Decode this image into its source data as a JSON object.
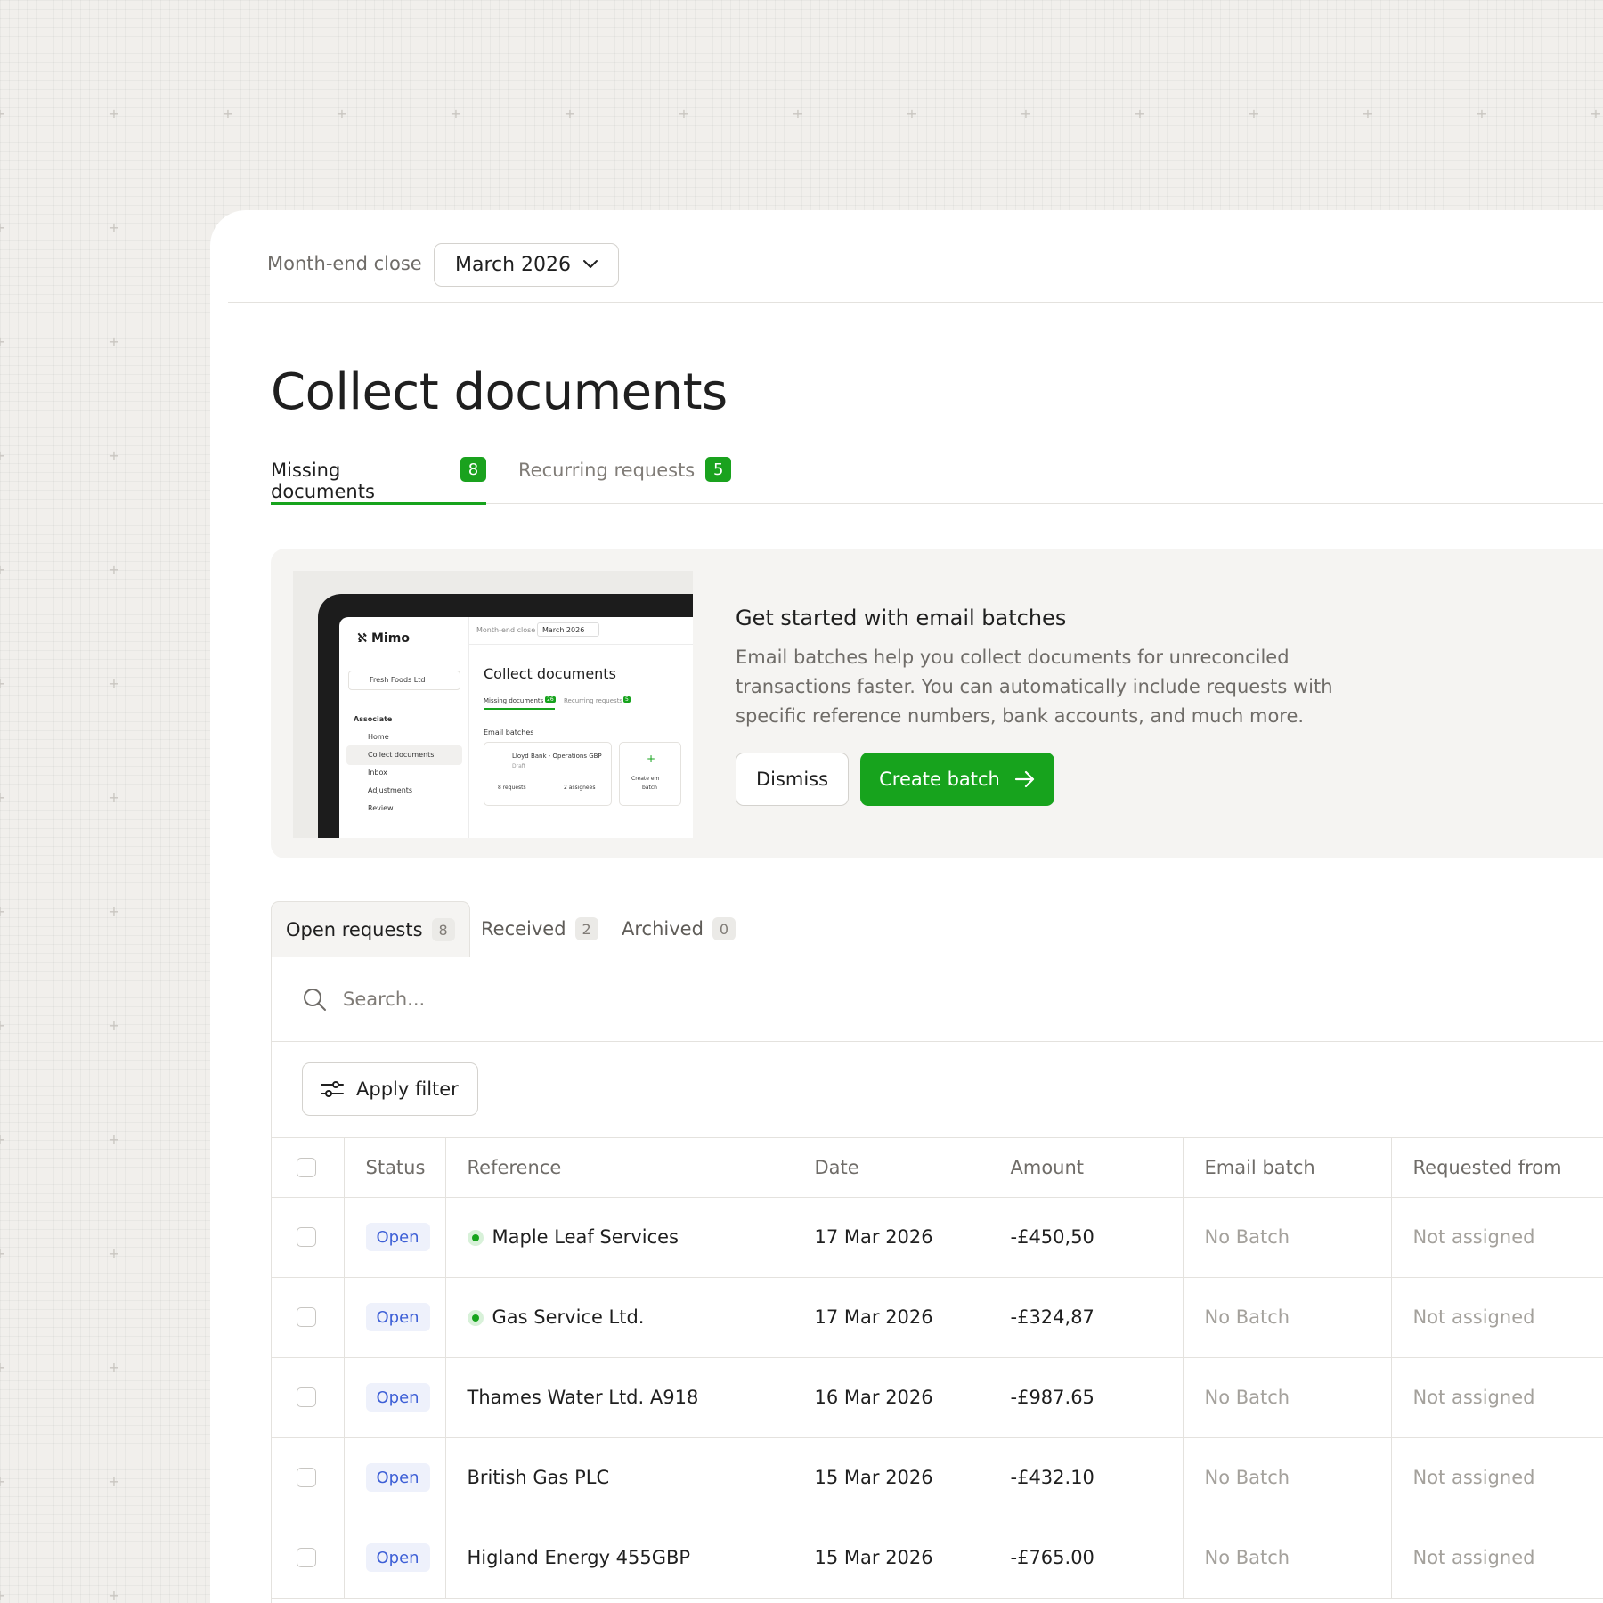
{
  "header": {
    "label": "Month-end close",
    "period": "March 2026"
  },
  "page": {
    "title": "Collect documents"
  },
  "tabs": [
    {
      "label": "Missing documents",
      "count": "8"
    },
    {
      "label": "Recurring requests",
      "count": "5"
    }
  ],
  "promo": {
    "title": "Get started with email batches",
    "text": "Email batches help you collect documents for unreconciled transactions faster. You can automatically include requests with specific reference numbers, bank accounts, and much more.",
    "dismiss_label": "Dismiss",
    "create_label": "Create batch",
    "preview": {
      "app_name": "Mimo",
      "client": "Fresh Foods Ltd",
      "section": "Associate",
      "nav": [
        "Home",
        "Collect documents",
        "Inbox",
        "Adjustments",
        "Review"
      ],
      "header_label": "Month-end close",
      "period": "March 2026",
      "title": "Collect documents",
      "tab1": "Missing documents",
      "tab1_count": "26",
      "tab2": "Recurring requests",
      "tab2_count": "5",
      "batches_label": "Email batches",
      "batch_name": "Lloyd Bank - Operations GBP",
      "batch_status": "Draft",
      "batch_requests": "8 requests",
      "batch_assignees": "2 assignees",
      "create_label_1": "Create em",
      "create_label_2": "batch"
    }
  },
  "request_tabs": [
    {
      "label": "Open requests",
      "count": "8"
    },
    {
      "label": "Received",
      "count": "2"
    },
    {
      "label": "Archived",
      "count": "0"
    }
  ],
  "search": {
    "placeholder": "Search..."
  },
  "filter": {
    "label": "Apply filter"
  },
  "table": {
    "columns": [
      "Status",
      "Reference",
      "Date",
      "Amount",
      "Email batch",
      "Requested from"
    ],
    "rows": [
      {
        "status": "Open",
        "reference": "Maple Leaf Services",
        "dot": true,
        "date": "17 Mar 2026",
        "amount": "-£450,50",
        "batch": "No Batch",
        "requested": "Not assigned"
      },
      {
        "status": "Open",
        "reference": "Gas Service Ltd.",
        "dot": true,
        "date": "17 Mar 2026",
        "amount": "-£324,87",
        "batch": "No Batch",
        "requested": "Not assigned"
      },
      {
        "status": "Open",
        "reference": "Thames Water Ltd. A918",
        "dot": false,
        "date": "16 Mar 2026",
        "amount": "-£987.65",
        "batch": "No Batch",
        "requested": "Not assigned"
      },
      {
        "status": "Open",
        "reference": "British Gas PLC",
        "dot": false,
        "date": "15 Mar 2026",
        "amount": "-£432.10",
        "batch": "No Batch",
        "requested": "Not assigned"
      },
      {
        "status": "Open",
        "reference": "Higland Energy 455GBP",
        "dot": false,
        "date": "15 Mar 2026",
        "amount": "-£765.00",
        "batch": "No Batch",
        "requested": "Not assigned"
      }
    ]
  },
  "colors": {
    "accent": "#17a31d",
    "status_open_bg": "#eef1fb",
    "status_open_text": "#3d5fd6",
    "background": "#f1efec"
  }
}
